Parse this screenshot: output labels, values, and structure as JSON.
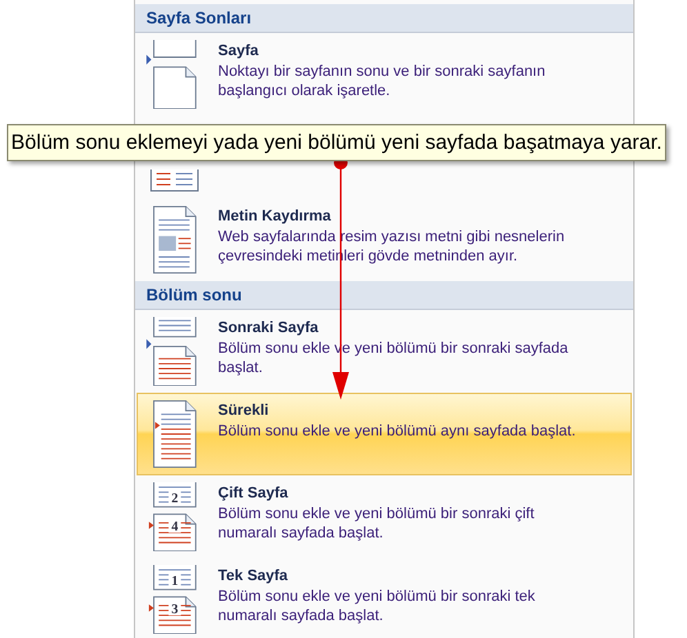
{
  "sections": [
    {
      "title": "Sayfa Sonları",
      "items": [
        {
          "kind": "page-break",
          "title": "Sayfa",
          "description": "Noktayı bir sayfanın sonu ve bir sonraki sayfanın başlangıcı olarak işaretle.",
          "selected": false
        },
        {
          "kind": "column"
        },
        {
          "kind": "text-wrap",
          "title": "Metin Kaydırma",
          "description": "Web sayfalarında resim yazısı metni gibi nesnelerin çevresindeki metinleri gövde metninden ayır.",
          "selected": false
        }
      ]
    },
    {
      "title": "Bölüm sonu",
      "items": [
        {
          "kind": "next-page",
          "title": "Sonraki Sayfa",
          "description": "Bölüm sonu ekle ve yeni bölümü bir sonraki sayfada başlat.",
          "selected": false
        },
        {
          "kind": "continuous",
          "title": "Sürekli",
          "description": "Bölüm sonu ekle ve yeni bölümü aynı sayfada başlat.",
          "selected": true
        },
        {
          "kind": "numbered",
          "icon_labels": [
            "2",
            "4"
          ],
          "title": "Çift Sayfa",
          "description": "Bölüm sonu ekle ve yeni bölümü bir sonraki çift numaralı sayfada başlat.",
          "selected": false
        },
        {
          "kind": "numbered",
          "icon_labels": [
            "1",
            "3"
          ],
          "title": "Tek Sayfa",
          "description": "Bölüm sonu ekle ve yeni bölümü bir sonraki tek numaralı sayfada başlat.",
          "selected": false
        }
      ]
    }
  ],
  "callout": {
    "text": "Bölüm sonu eklemeyi yada yeni bölümü yeni sayfada başatmaya yarar."
  }
}
